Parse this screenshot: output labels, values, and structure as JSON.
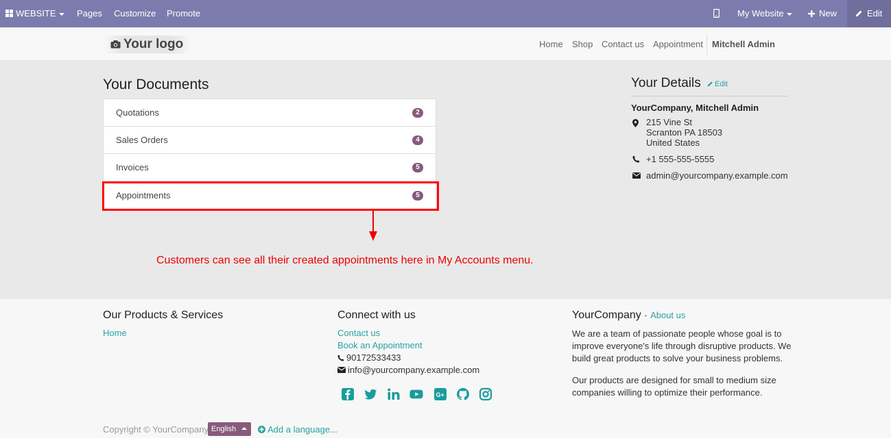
{
  "adminbar": {
    "website_label": "WEBSITE",
    "pages": "Pages",
    "customize": "Customize",
    "promote": "Promote",
    "my_website": "My Website",
    "new": "New",
    "edit": "Edit"
  },
  "navbar": {
    "logo": "Your logo",
    "links": [
      "Home",
      "Shop",
      "Contact us",
      "Appointment"
    ],
    "user": "Mitchell Admin"
  },
  "documents": {
    "title": "Your Documents",
    "rows": [
      {
        "label": "Quotations",
        "count": "2"
      },
      {
        "label": "Sales Orders",
        "count": "4"
      },
      {
        "label": "Invoices",
        "count": "5"
      },
      {
        "label": "Appointments",
        "count": "5"
      }
    ]
  },
  "annotation": "Customers can see all their created appointments here in My Accounts menu.",
  "details": {
    "title": "Your Details",
    "edit": "Edit",
    "company": "YourCompany, Mitchell Admin",
    "address_line1": "215 Vine St",
    "address_line2": "Scranton PA 18503",
    "address_line3": "United States",
    "phone": "+1 555-555-5555",
    "email": "admin@yourcompany.example.com"
  },
  "footer": {
    "col1_title": "Our Products & Services",
    "col1_link": "Home",
    "col2_title": "Connect with us",
    "col2_contact": "Contact us",
    "col2_book": "Book an Appointment",
    "col2_phone": "90172533433",
    "col2_email": "info@yourcompany.example.com",
    "col3_title": "YourCompany",
    "col3_sep": "-",
    "col3_about": "About us",
    "col3_p1": "We are a team of passionate people whose goal is to improve everyone's life through disruptive products. We build great products to solve your business problems.",
    "col3_p2": "Our products are designed for small to medium size companies willing to optimize their performance.",
    "social_icons": [
      "facebook-icon",
      "twitter-icon",
      "linkedin-icon",
      "youtube-icon",
      "google-plus-icon",
      "github-icon",
      "instagram-icon"
    ],
    "copyright": "Copyright © YourCompany",
    "language": "English",
    "add_language": "Add a language..."
  },
  "colors": {
    "adminbar": "#7c7bad",
    "brand": "#875a7b",
    "link": "#2aa1a1",
    "annotation": "#ff0000"
  }
}
